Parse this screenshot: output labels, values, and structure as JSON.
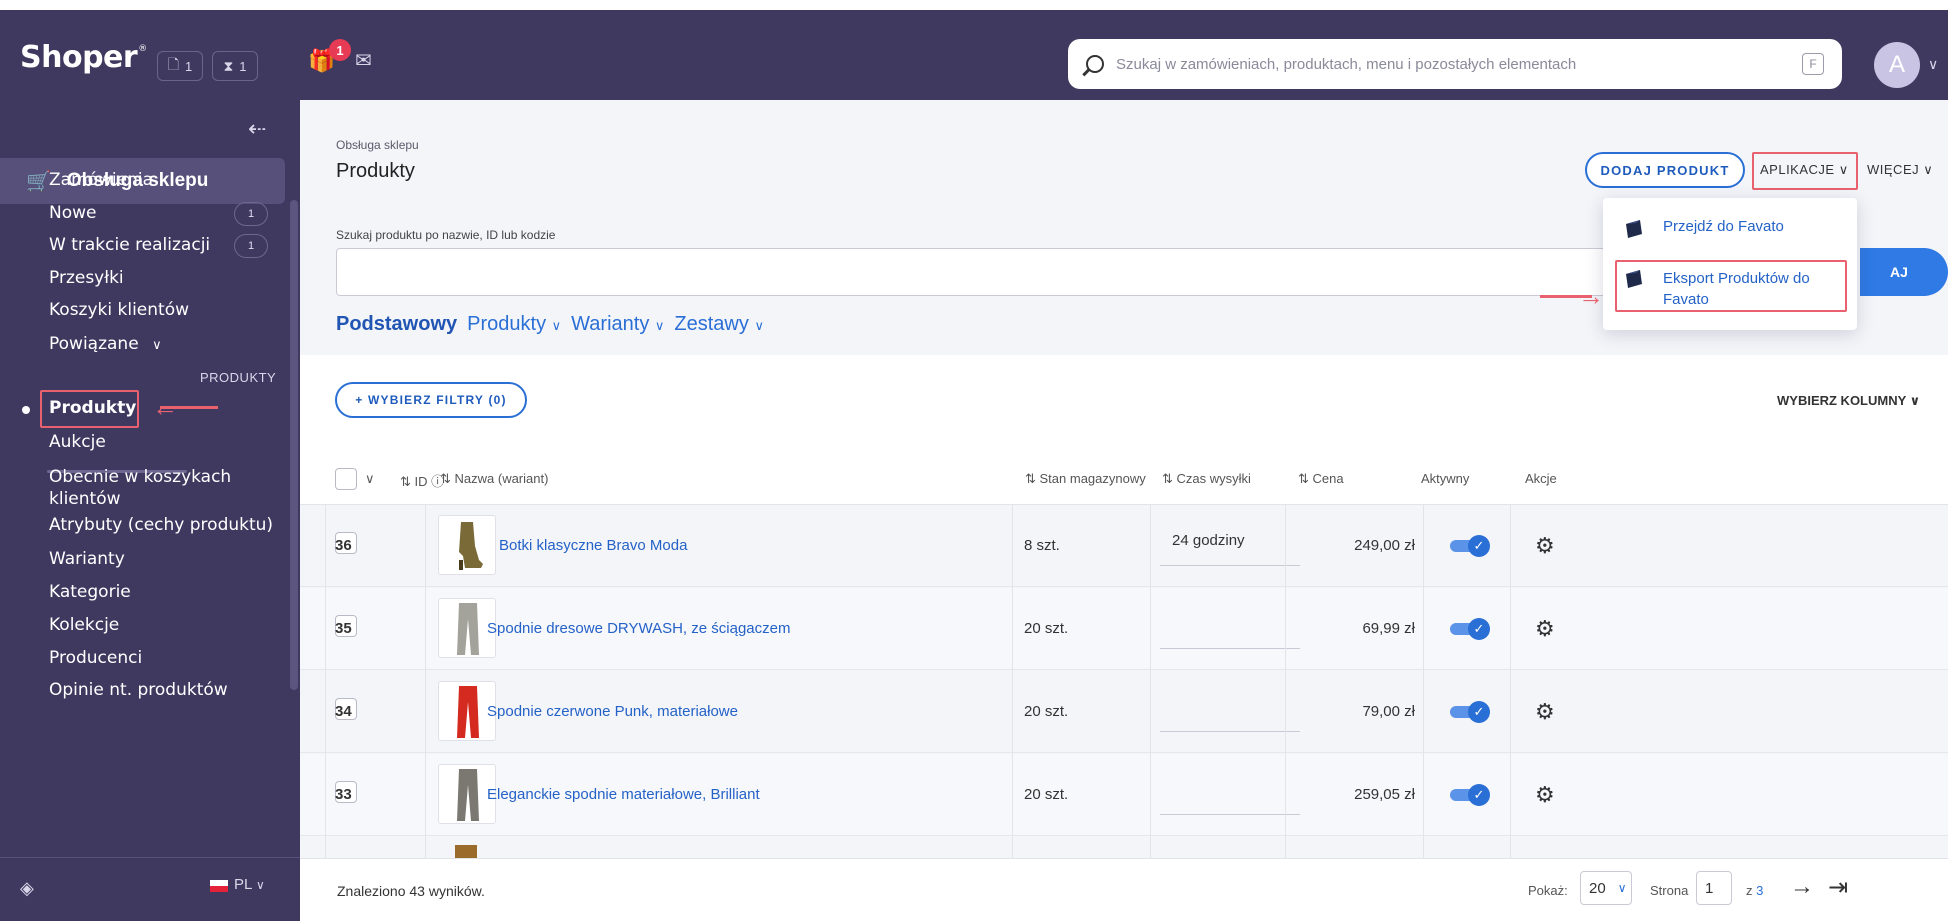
{
  "header": {
    "logo": "Shoper",
    "logo_mark": "®",
    "chip1_count": "1",
    "chip2_count": "1",
    "gift_badge": "1",
    "search_placeholder": "Szukaj w zamówieniach, produktach, menu i pozostałych elementach",
    "search_kbd": "F",
    "avatar_letter": "A"
  },
  "sidebar": {
    "section": "Obsługa sklepu",
    "items": [
      {
        "label": "Zamówienia"
      },
      {
        "label": "Nowe",
        "badge": "1"
      },
      {
        "label": "W trakcie realizacji",
        "badge": "1"
      },
      {
        "label": "Przesyłki"
      },
      {
        "label": "Koszyki klientów"
      },
      {
        "label": "Powiązane"
      }
    ],
    "group_label": "PRODUKTY",
    "group_items": [
      {
        "label": "Produkty"
      },
      {
        "label": "Aukcje"
      },
      {
        "label": "Obecnie w koszykach klientów"
      },
      {
        "label": "Atrybuty (cechy produktu)"
      },
      {
        "label": "Warianty"
      },
      {
        "label": "Kategorie"
      },
      {
        "label": "Kolekcje"
      },
      {
        "label": "Producenci"
      },
      {
        "label": "Opinie nt. produktów"
      }
    ],
    "language": "PL"
  },
  "page": {
    "breadcrumb": "Obsługa sklepu",
    "title": "Produkty",
    "add_button": "DODAJ PRODUKT",
    "apps_button": "APLIKACJE",
    "more_button": "WIĘCEJ",
    "search_label": "Szukaj produktu po nazwie, ID lub kodzie",
    "search_button": "AJ",
    "view_tabs": [
      "Podstawowy",
      "Produkty",
      "Warianty",
      "Zestawy"
    ],
    "filter_button": "+ WYBIERZ FILTRY (0)",
    "columns_button": "WYBIERZ KOLUMNY"
  },
  "apps_menu": {
    "items": [
      "Przejdź do Favato",
      "Eksport Produktów do Favato"
    ]
  },
  "table": {
    "headers": {
      "id": "ID",
      "name": "Nazwa (wariant)",
      "stock": "Stan magazynowy",
      "shipping": "Czas wysyłki",
      "price": "Cena",
      "active": "Aktywny",
      "actions": "Akcje"
    },
    "rows": [
      {
        "id": "36",
        "name": "Botki klasyczne Bravo Moda",
        "stock": "8 szt.",
        "shipping": "24 godziny",
        "price": "249,00 zł",
        "active": true
      },
      {
        "id": "35",
        "name": "Spodnie dresowe DRYWASH, ze ściągaczem",
        "stock": "20 szt.",
        "shipping": "",
        "price": "69,99 zł",
        "active": true
      },
      {
        "id": "34",
        "name": "Spodnie czerwone Punk, materiałowe",
        "stock": "20 szt.",
        "shipping": "",
        "price": "79,00 zł",
        "active": true
      },
      {
        "id": "33",
        "name": "Eleganckie spodnie materiałowe, Brilliant",
        "stock": "20 szt.",
        "shipping": "",
        "price": "259,05 zł",
        "active": true
      }
    ]
  },
  "footer": {
    "found": "Znaleziono 43 wyników.",
    "show_label": "Pokaż:",
    "per_page": "20",
    "page_label": "Strona",
    "page_value": "1",
    "of_label": "z",
    "total_pages": "3"
  },
  "colors": {
    "sidebar_bg": "#3f3960",
    "accent": "#2a6fd6",
    "highlight": "#e9616e",
    "badge": "#e73a55"
  }
}
